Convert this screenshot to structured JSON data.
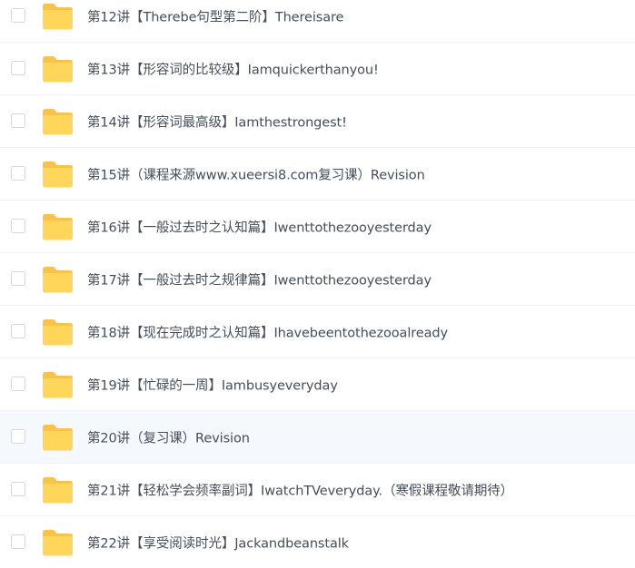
{
  "file_list": {
    "items": [
      {
        "name": "第12讲【Therebe句型第二阶】Thereisare"
      },
      {
        "name": "第13讲【形容词的比较级】Iamquickerthanyou!"
      },
      {
        "name": "第14讲【形容词最高级】Iamthestrongest!"
      },
      {
        "name": "第15讲（课程来源www.xueersi8.com复习课）Revision"
      },
      {
        "name": "第16讲【一般过去时之认知篇】Iwenttothezooyesterday"
      },
      {
        "name": "第17讲【一般过去时之规律篇】Iwenttothezooyesterday"
      },
      {
        "name": "第18讲【现在完成时之认知篇】Ihavebeentothezooalready"
      },
      {
        "name": "第19讲【忙碌的一周】Iambusyeveryday"
      },
      {
        "name": "第20讲（复习课）Revision",
        "hovered": true
      },
      {
        "name": "第21讲【轻松学会频率副词】IwatchTVeveryday.（寒假课程敬请期待）"
      },
      {
        "name": "第22讲【享受阅读时光】Jackandbeanstalk"
      }
    ],
    "folder_color": "#FFD55A",
    "folder_tab_color": "#F7C34A"
  }
}
